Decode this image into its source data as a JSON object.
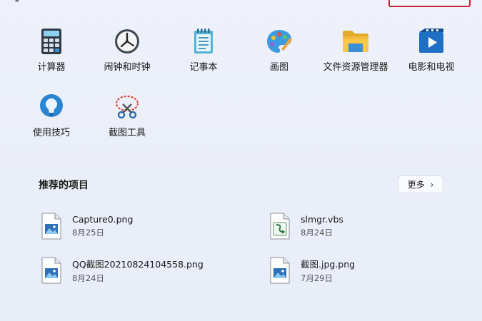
{
  "top_fragment": "g",
  "pinned_apps": [
    {
      "label": "计算器",
      "icon": "calculator-icon"
    },
    {
      "label": "闹钟和时钟",
      "icon": "clock-icon"
    },
    {
      "label": "记事本",
      "icon": "notepad-icon"
    },
    {
      "label": "画图",
      "icon": "paint-icon"
    },
    {
      "label": "文件资源管理器",
      "icon": "folder-icon"
    },
    {
      "label": "电影和电视",
      "icon": "movies-tv-icon"
    },
    {
      "label": "使用技巧",
      "icon": "tips-icon"
    },
    {
      "label": "截图工具",
      "icon": "snipping-tool-icon"
    }
  ],
  "recommended": {
    "title": "推荐的项目",
    "more_label": "更多",
    "more_chevron": "›",
    "items": [
      {
        "name": "Capture0.png",
        "date": "8月25日",
        "icon": "image-file-icon"
      },
      {
        "name": "slmgr.vbs",
        "date": "8月24日",
        "icon": "script-file-icon"
      },
      {
        "name": "QQ截图20210824104558.png",
        "date": "8月24日",
        "icon": "image-file-icon"
      },
      {
        "name": "截图.jpg.png",
        "date": "7月29日",
        "icon": "image-file-icon"
      }
    ]
  },
  "colors": {
    "background": "#ebeff8",
    "highlight_border": "#cc2233"
  }
}
